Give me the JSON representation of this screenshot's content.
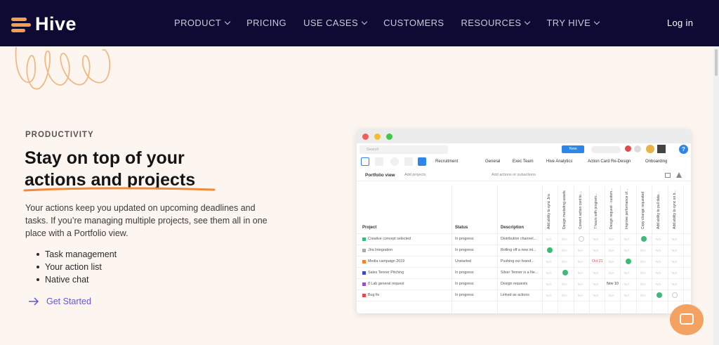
{
  "nav": {
    "brand": "Hive",
    "items": [
      {
        "label": "PRODUCT",
        "dropdown": true
      },
      {
        "label": "PRICING",
        "dropdown": false
      },
      {
        "label": "USE CASES",
        "dropdown": true
      },
      {
        "label": "CUSTOMERS",
        "dropdown": false
      },
      {
        "label": "RESOURCES",
        "dropdown": true
      },
      {
        "label": "TRY HIVE",
        "dropdown": true
      }
    ],
    "login": "Log in"
  },
  "hero": {
    "kicker": "PRODUCTIVITY",
    "headline_line1": "Stay on top of your",
    "headline_line2": "actions and projects",
    "description": "Your actions keep you updated on upcoming deadlines and tasks. If you’re managing multiple projects, see them all in one place with a Portfolio view.",
    "bullets": [
      "Task management",
      "Your action list",
      "Native chat"
    ],
    "cta": "Get Started"
  },
  "app": {
    "search_placeholder": "Search",
    "new_button": "New",
    "tabs": [
      "Recruitment",
      "General",
      "Exec Team",
      "Hive Analytics",
      "Action Card Re-Design",
      "Onboarding"
    ],
    "portfolio_title": "Portfolio view",
    "add_projects": "Add projects",
    "add_actions": "Add actions or subactions",
    "headers": {
      "project": "Project",
      "status": "Status",
      "description": "Description"
    },
    "columns": [
      "Add ability to sync Jira",
      "Design marketing assets",
      "Convert action card to ...",
      "7 hours with program...",
      "Design request - custom...",
      "Improve performance of...",
      "Copy change requested",
      "Add ability to pull data...",
      "Add ability to sync on b..."
    ],
    "rows": [
      {
        "project": "Creative concept selected",
        "status": "In progress",
        "description": "Distribution channel...",
        "color": "#3eb97a"
      },
      {
        "project": "Jira Integration",
        "status": "In progress",
        "description": "Rolling off a new int...",
        "color": "#aaaaaa"
      },
      {
        "project": "Media campaign 2019",
        "status": "Unstarted",
        "description": "Pushing our brand...",
        "color": "#e8833a"
      },
      {
        "project": "Sales Tenner Pitching",
        "status": "In progress",
        "description": "Silver Tenner is a Ne...",
        "color": "#3a4fb5"
      },
      {
        "project": "8 Lab general request",
        "status": "In progress",
        "description": "Design requests",
        "color": "#9b4fc0"
      },
      {
        "project": "Bug fix",
        "status": "In progress",
        "description": "Linked as actions",
        "color": "#e24b4b"
      }
    ],
    "date_labels": [
      "Oct 21",
      "Nov 10"
    ],
    "na_label": "N/A"
  },
  "colors": {
    "nav_bg": "#0d0b33",
    "accent": "#f5a04a",
    "cta": "#6257d8",
    "page_bg": "#fdf5f0"
  }
}
